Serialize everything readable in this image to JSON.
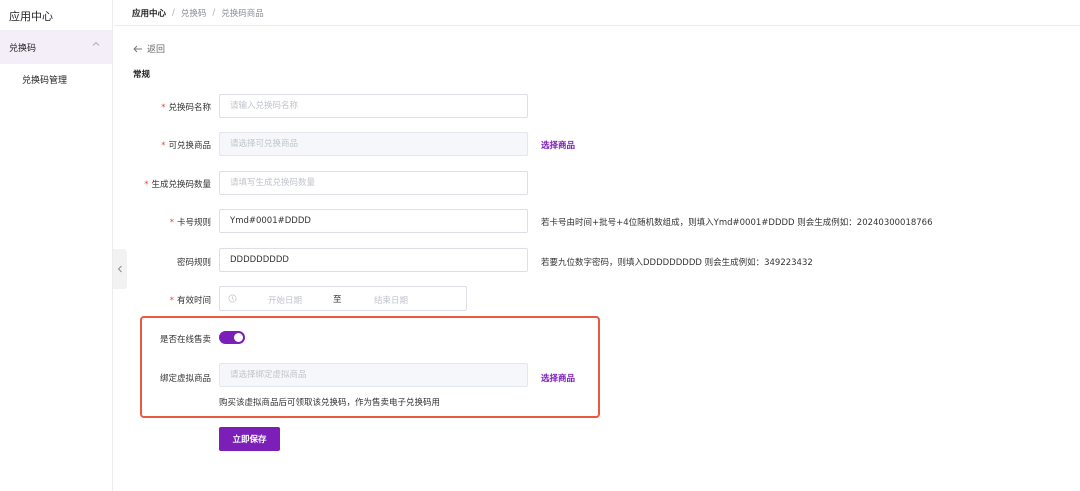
{
  "sidebar": {
    "app_title": "应用中心",
    "group_label": "兑换码",
    "sub_item": "兑换码管理"
  },
  "breadcrumb": [
    "应用中心",
    "兑换码",
    "兑换码商品"
  ],
  "breadcrumb_sep": "/",
  "back_label": "返回",
  "section_title": "常规",
  "form": {
    "name": {
      "label": "兑换码名称",
      "placeholder": "请输入兑换码名称"
    },
    "product": {
      "label": "可兑换商品",
      "placeholder": "请选择可兑换商品",
      "link": "选择商品"
    },
    "count": {
      "label": "生成兑换码数量",
      "placeholder": "请填写生成兑换码数量"
    },
    "card_rule": {
      "label": "卡号规则",
      "value": "Ymd#0001#DDDD",
      "hint": "若卡号由时间+批号+4位随机数组成，则填入Ymd#0001#DDDD 则会生成例如：20240300018766"
    },
    "pwd_rule": {
      "label": "密码规则",
      "value": "DDDDDDDDD",
      "hint": "若要九位数字密码，则填入DDDDDDDDD 则会生成例如：349223432"
    },
    "valid_time": {
      "label": "有效时间",
      "start": "开始日期",
      "to": "至",
      "end": "结束日期"
    },
    "online_sale": {
      "label": "是否在线售卖",
      "enabled": true
    },
    "virtual": {
      "label": "绑定虚拟商品",
      "placeholder": "请选择绑定虚拟商品",
      "link": "选择商品",
      "note": "购买该虚拟商品后可领取该兑换码，作为售卖电子兑换码用"
    }
  },
  "required_mark": "*",
  "save_label": "立即保存",
  "colors": {
    "accent": "#7b1fb8",
    "highlight": "#ea5a3e",
    "required": "#e34a3c"
  }
}
